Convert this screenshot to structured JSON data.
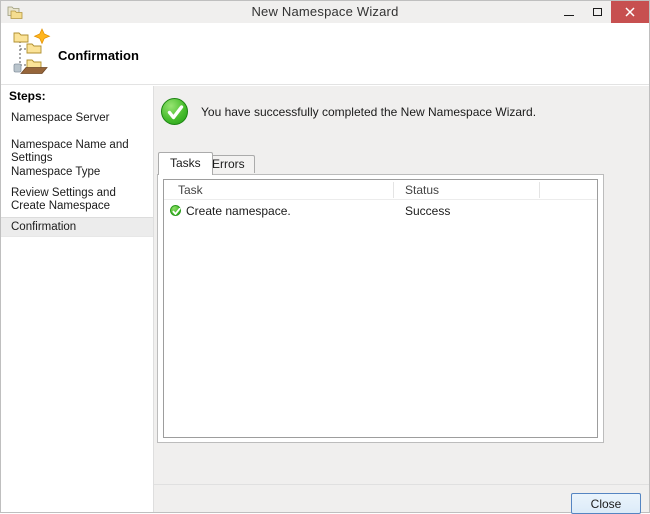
{
  "window": {
    "title": "New Namespace Wizard",
    "controls": {
      "minimize_icon": "minimize-dash",
      "maximize_icon": "maximize-square",
      "close_icon": "close-x"
    }
  },
  "header": {
    "title": "Confirmation"
  },
  "sidebar": {
    "heading": "Steps:",
    "items": [
      {
        "label": "Namespace Server",
        "selected": false
      },
      {
        "label": "Namespace Name and Settings",
        "selected": false
      },
      {
        "label": "Namespace Type",
        "selected": false
      },
      {
        "label": "Review Settings and Create Namespace",
        "selected": false
      },
      {
        "label": "Confirmation",
        "selected": true
      }
    ]
  },
  "main": {
    "message": "You have successfully completed the New Namespace Wizard.",
    "tabs": [
      {
        "label": "Tasks",
        "active": true
      },
      {
        "label": "Errors",
        "active": false
      }
    ],
    "table": {
      "columns": [
        "Task",
        "Status"
      ],
      "rows": [
        {
          "task": "Create namespace.",
          "status": "Success",
          "icon": "success-check"
        }
      ]
    }
  },
  "footer": {
    "close_label": "Close"
  },
  "colors": {
    "titlebar_bg": "#f0efee",
    "close_button_red": "#c75050",
    "success_green": "#3cb428",
    "selected_step_bg": "#ececec",
    "content_bg": "#f0efee",
    "focused_button_border": "#5585c2"
  }
}
